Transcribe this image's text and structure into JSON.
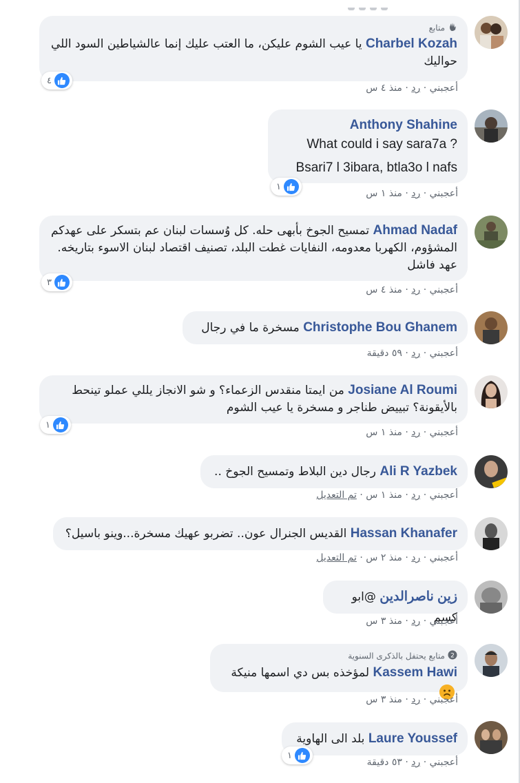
{
  "colors": {
    "name": "#385898",
    "bubble": "#f0f2f5",
    "meta": "#606770",
    "like": "#2e89ff"
  },
  "meta_labels": {
    "like": "أعجبني",
    "reply": "رد",
    "sep": "·",
    "edited": "تم التعديل"
  },
  "comments": [
    {
      "badge": "متابع",
      "badge_icon": "wave-hand-icon",
      "name": "Charbel Kozah",
      "lines": [
        "يا عيب الشوم عليكن، ما العتب عليك إنما عالشياطين السود اللي",
        "حواليك"
      ],
      "time": "منذ ٤ س",
      "reactions": "٤"
    },
    {
      "name": "Anthony Shahine",
      "lines": [
        "What could i say sara7a ?",
        "Bsari7 l 3ibara, btla3o l nafs"
      ],
      "time": "منذ ١ س",
      "reactions": "١"
    },
    {
      "name": "Ahmad Nadaf",
      "lines": [
        "تمسيح الجوخ بأبهى حله. كل وُسسات لبنان عم بتسكر على عهدكم",
        "المشؤوم، الكهربا معدومه، النفايات غطت البلد، تصنيف اقتصاد لبنان الاسوء بتاريخه.",
        "عهد فاشل"
      ],
      "time": "منذ ٤ س",
      "reactions": "٣"
    },
    {
      "name": "Christophe Bou Ghanem",
      "lines": [
        "مسخرة ما في رجال"
      ],
      "time": "٥٩ دقيقة"
    },
    {
      "name": "Josiane Al Roumi",
      "lines": [
        "من ايمتا منقدس الزعماء؟ و شو الانجاز يللي عملو تينحط",
        "بالأيقونة؟ تبييض طناجر و مسخرة يا عيب الشوم"
      ],
      "time": "منذ ١ س",
      "reactions": "١"
    },
    {
      "name": "Ali R Yazbek",
      "lines": [
        "رجال دين البلاط وتمسيح الجوخ .."
      ],
      "time": "منذ ١ س",
      "edited": true
    },
    {
      "name": "Hassan Khanafer",
      "lines": [
        "القديس الجنرال عون.. تضربو عهيك مسخرة...وينو باسيل؟"
      ],
      "time": "منذ ٢ س",
      "edited": true
    },
    {
      "name": "زين ناصرالدين",
      "lines": [
        "@ابو كسم"
      ],
      "time": "منذ ٣ س"
    },
    {
      "badge": "متابع يحتفل بالذكرى السنوية",
      "badge_icon": "anniversary-badge-icon",
      "badge_num": "2",
      "name": "Kassem Hawi",
      "lines": [
        "لمؤخذه بس دي اسمها منيكة"
      ],
      "time": "منذ ٣ س",
      "emoji": "sad-face-icon"
    },
    {
      "name": "Laure Youssef",
      "lines": [
        "بلد الى الهاوية"
      ],
      "time": "٥٣ دقيقة",
      "reactions": "١"
    }
  ]
}
